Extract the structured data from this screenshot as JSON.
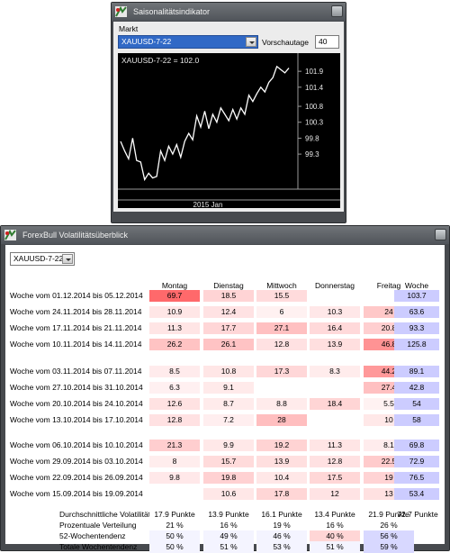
{
  "window1": {
    "title": "Saisonalitätsindikator",
    "market_label": "Markt",
    "market_value": "XAUUSD-7-22",
    "preview_label": "Vorschautage",
    "preview_value": "40"
  },
  "chart_data": {
    "type": "line",
    "title": "XAUUSD-7-22 = 102.0",
    "xlabel": "2015 Jan",
    "ylabel": "",
    "ylim": [
      98.2,
      102.3
    ],
    "yticks": [
      "101.9",
      "101.4",
      "100.8",
      "100.3",
      "99.8",
      "99.3"
    ],
    "series": [
      {
        "values": [
          99.7,
          99.4,
          99.15,
          99.8,
          99.1,
          99.05,
          98.5,
          98.7,
          98.55,
          98.6,
          99.4,
          99.1,
          99.55,
          99.3,
          99.6,
          99.2,
          99.7,
          99.95,
          99.75,
          100.5,
          100.15,
          100.65,
          100.1,
          100.55,
          100.3,
          100.75,
          100.55,
          100.35,
          100.7,
          100.4,
          100.75,
          100.55,
          101.15,
          100.95,
          101.2,
          101.4,
          101.25,
          101.55,
          101.7,
          102.05,
          101.95,
          101.85,
          102.0
        ]
      }
    ]
  },
  "window2": {
    "title": "ForexBull Volatilitätsüberblick",
    "market_value": "XAUUSD-7-22",
    "days": [
      "Montag",
      "Dienstag",
      "Mittwoch",
      "Donnerstag",
      "Freitag"
    ],
    "week_header": "Woche",
    "rows": [
      {
        "label": "Woche vom 01.12.2014 bis 05.12.2014",
        "values": [
          "69.7",
          "18.5",
          "15.5",
          "",
          ""
        ],
        "week": "103.7"
      },
      {
        "label": "Woche vom 24.11.2014 bis 28.11.2014",
        "values": [
          "10.9",
          "12.4",
          "6",
          "10.3",
          "24"
        ],
        "week": "63.6"
      },
      {
        "label": "Woche vom 17.11.2014 bis 21.11.2014",
        "values": [
          "11.3",
          "17.7",
          "27.1",
          "16.4",
          "20.8"
        ],
        "week": "93.3"
      },
      {
        "label": "Woche vom 10.11.2014 bis 14.11.2014",
        "values": [
          "26.2",
          "26.1",
          "12.8",
          "13.9",
          "46.8"
        ],
        "week": "125.8"
      },
      {
        "label": "Woche vom 03.11.2014 bis 07.11.2014",
        "values": [
          "8.5",
          "10.8",
          "17.3",
          "8.3",
          "44.2"
        ],
        "week": "89.1"
      },
      {
        "label": "Woche vom 27.10.2014 bis 31.10.2014",
        "values": [
          "6.3",
          "9.1",
          "",
          "",
          "27.4"
        ],
        "week": "42.8"
      },
      {
        "label": "Woche vom 20.10.2014 bis 24.10.2014",
        "values": [
          "12.6",
          "8.7",
          "8.8",
          "18.4",
          "5.5"
        ],
        "week": "54"
      },
      {
        "label": "Woche vom 13.10.2014 bis 17.10.2014",
        "values": [
          "12.8",
          "7.2",
          "28",
          "",
          "10"
        ],
        "week": "58"
      },
      {
        "label": "Woche vom 06.10.2014 bis 10.10.2014",
        "values": [
          "21.3",
          "9.9",
          "19.2",
          "11.3",
          "8.1"
        ],
        "week": "69.8"
      },
      {
        "label": "Woche vom 29.09.2014 bis 03.10.2014",
        "values": [
          "8",
          "15.7",
          "13.9",
          "12.8",
          "22.5"
        ],
        "week": "72.9"
      },
      {
        "label": "Woche vom 22.09.2014 bis 26.09.2014",
        "values": [
          "9.8",
          "19.8",
          "10.4",
          "17.5",
          "19"
        ],
        "week": "76.5"
      },
      {
        "label": "Woche vom 15.09.2014 bis 19.09.2014",
        "values": [
          "",
          "10.6",
          "17.8",
          "12",
          "13"
        ],
        "week": "53.4"
      }
    ],
    "summary": {
      "avg_label": "Durchschnittliche Volatilität",
      "avg_values": [
        "17.9 Punkte",
        "13.9 Punkte",
        "16.1 Punkte",
        "13.4 Punkte",
        "21.9 Punkte"
      ],
      "avg_week": "72.7 Punkte",
      "dist_label": "Prozentuale Verteilung",
      "dist_values": [
        "21 %",
        "16 %",
        "19 %",
        "16 %",
        "26 %"
      ],
      "trend52_label": "52-Wochentendenz",
      "trend52_values": [
        "50 %",
        "49 %",
        "46 %",
        "40 %",
        "56 %"
      ],
      "total_label": "Totale Wochentendenz",
      "total_values": [
        "50 %",
        "51 %",
        "53 %",
        "51 %",
        "59 %"
      ]
    },
    "colors": {
      "cell_high": "#f07c80",
      "week_cell": "#ccccff"
    }
  }
}
